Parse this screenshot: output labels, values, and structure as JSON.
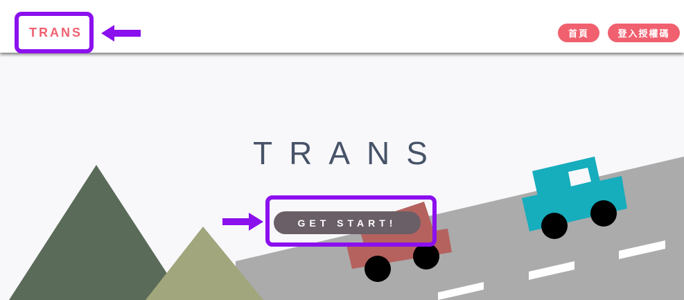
{
  "header": {
    "logo": "TRANS",
    "nav": [
      {
        "label": "首頁"
      },
      {
        "label": "登入授權碼"
      }
    ]
  },
  "hero": {
    "title": "TRANS",
    "cta_label": "GET START!"
  },
  "colors": {
    "brand": "#f0606f",
    "title": "#475367",
    "cta": "#6a5f66",
    "highlight": "#8b10ee",
    "road": "#ababab",
    "mountain_dark": "#5b6b59",
    "mountain_light": "#a1a67c",
    "car_teal": "#16adbd",
    "car_red": "#b5625f"
  }
}
